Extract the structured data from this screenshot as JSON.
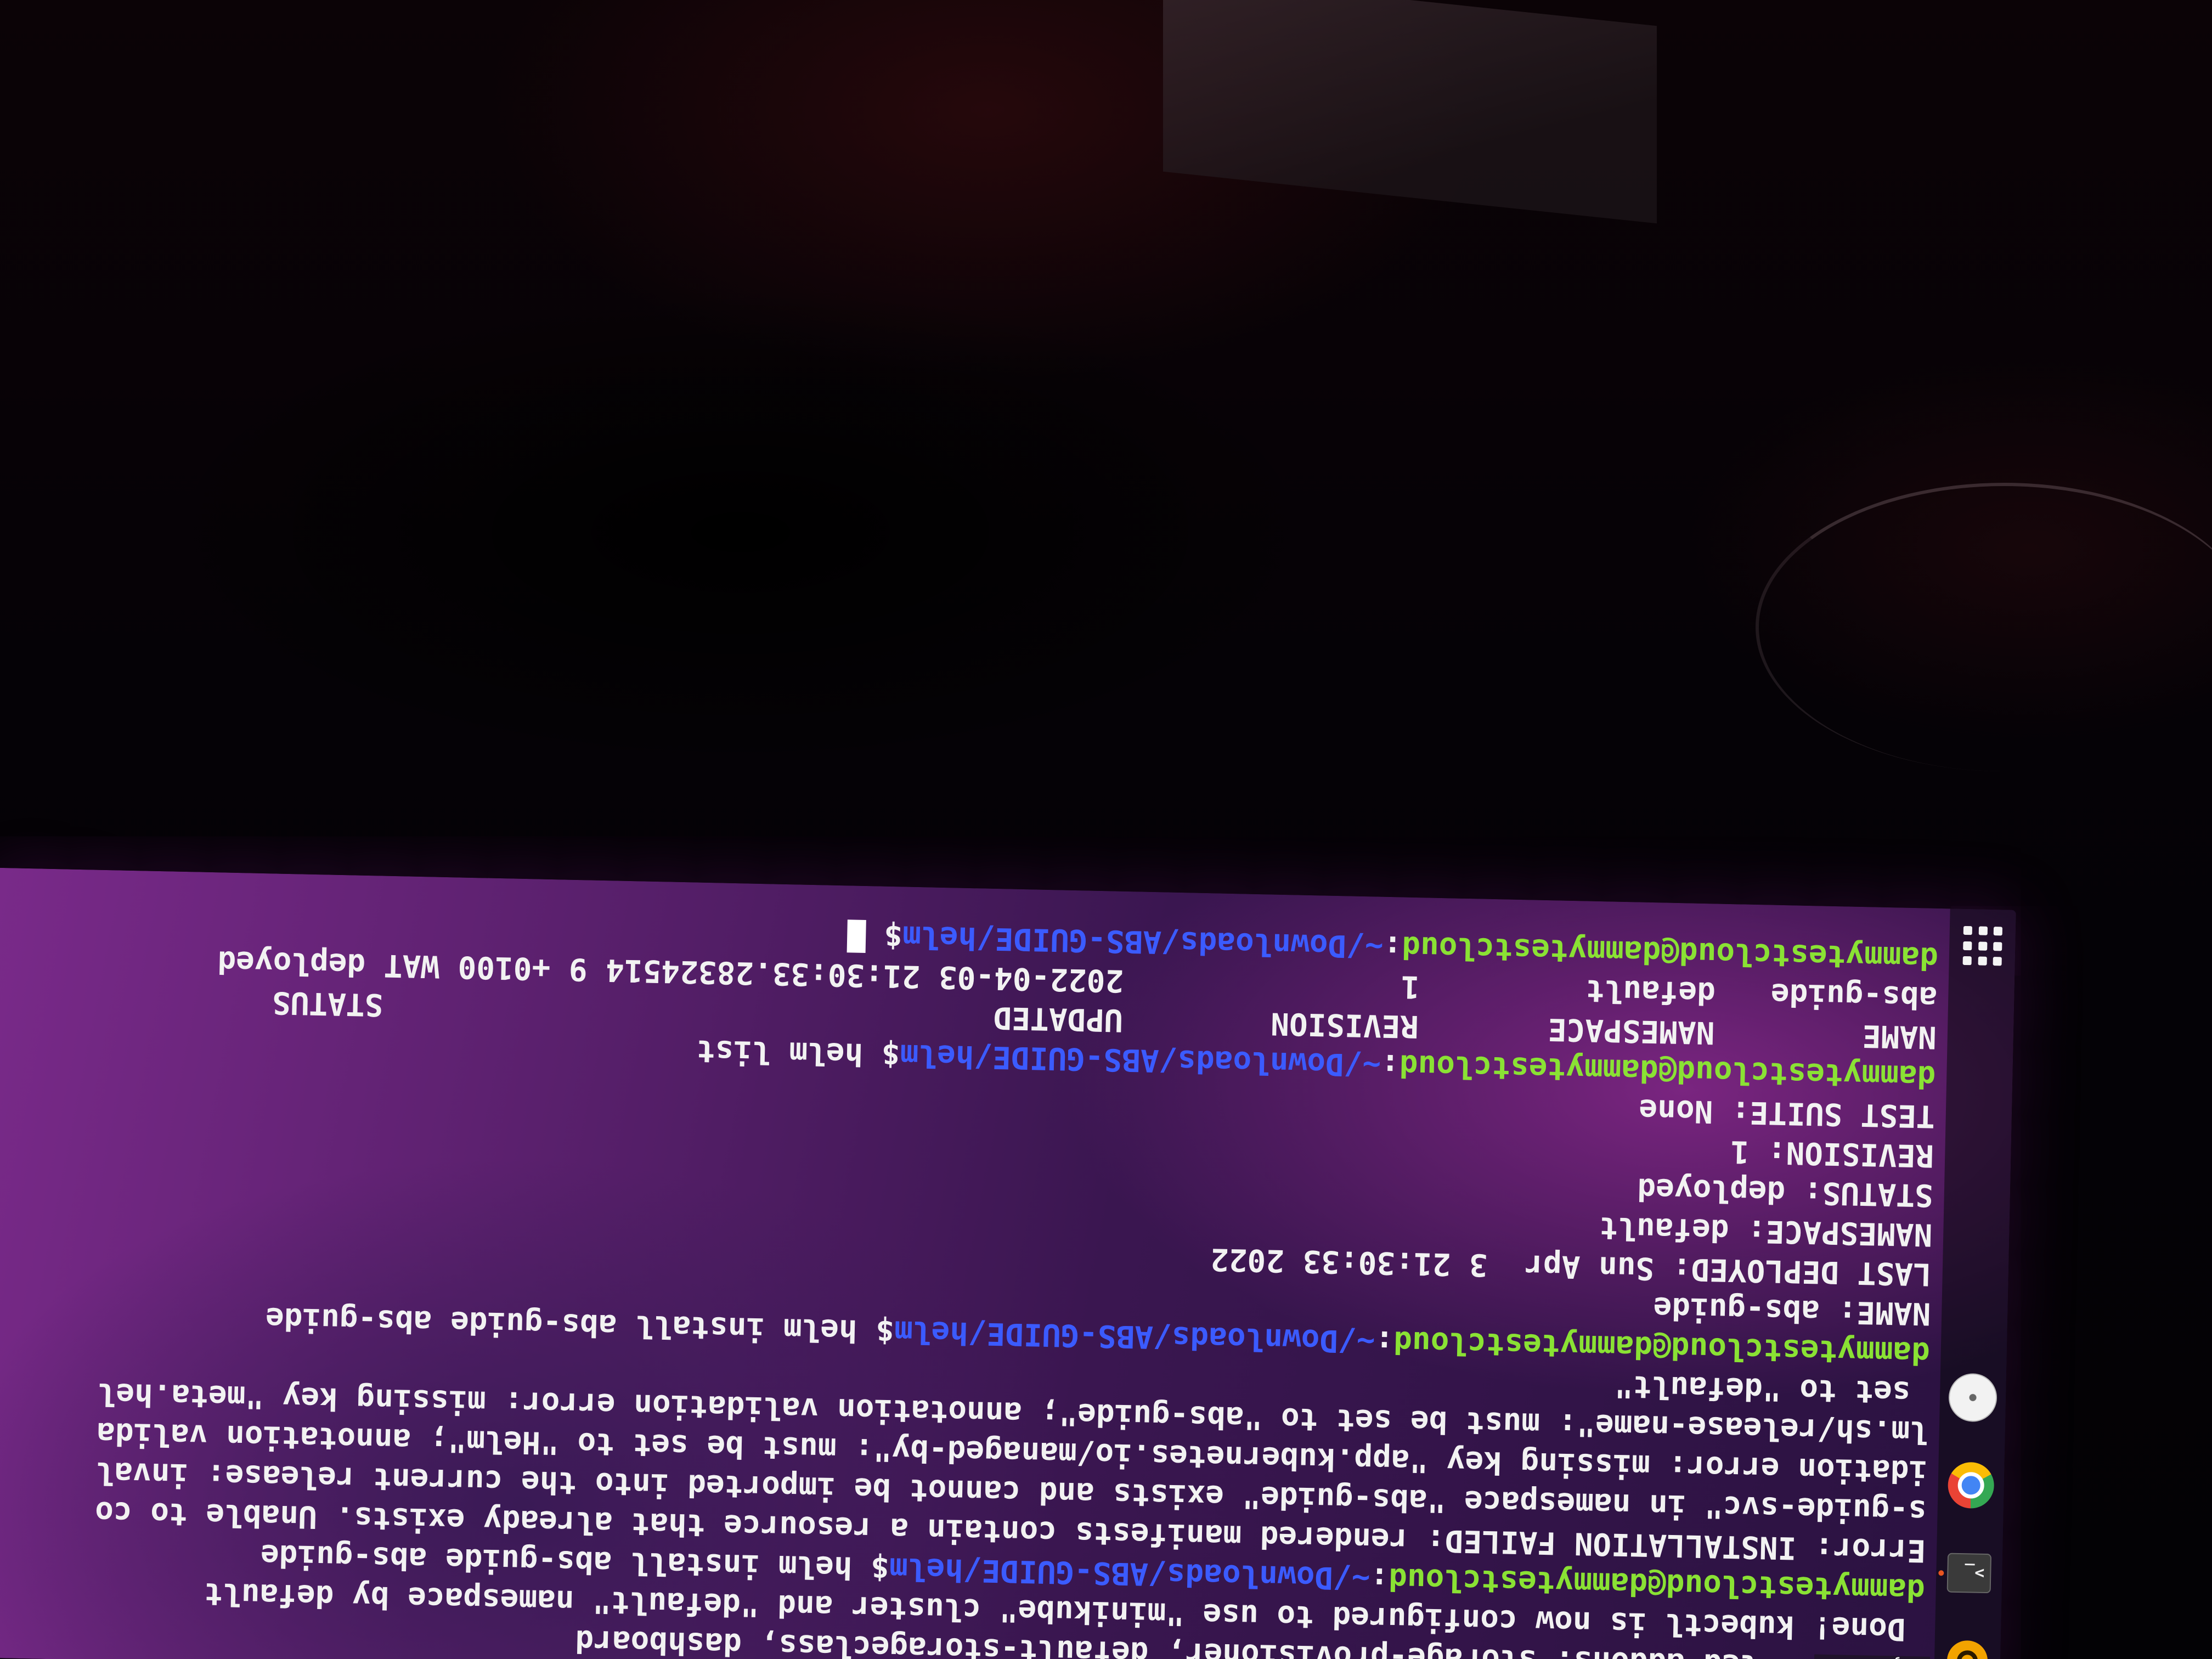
{
  "dock": {
    "tooltip": "Rhythmbox",
    "terminal_glyph": ">_",
    "items": [
      "rhythmbox-icon",
      "terminal-icon",
      "chrome-icon",
      "disc-icon",
      "show-apps-icon"
    ]
  },
  "colors": {
    "prompt_user": "#8ae234",
    "prompt_path": "#3b5bff",
    "text": "#f2f2f2"
  },
  "terminal": {
    "prompt_user": "dammytestcloud@dammytestcloud",
    "prompt_path": "~/Downloads/ABS-GUIDE/helm",
    "lines": [
      {
        "type": "out",
        "text": "led addons: storage-provisioner, default-storageclass, dashboard"
      },
      {
        "type": "out",
        "text": " Done! kubectl is now configured to use \"minikube\" cluster and \"default\" namespace by default"
      },
      {
        "type": "cmd",
        "text": "helm install abs-guide abs-guide"
      },
      {
        "type": "out",
        "text": "Error: INSTALLATION FAILED: rendered manifests contain a resource that already exists. Unable to co"
      },
      {
        "type": "out",
        "text": "s-guide-svc\" in namespace \"abs-guide\" exists and cannot be imported into the current release: inval"
      },
      {
        "type": "out",
        "text": "idation error: missing key \"app.kubernetes.io/managed-by\": must be set to \"Helm\"; annotation valida"
      },
      {
        "type": "out",
        "text": "lm.sh/release-name\": must be set to \"abs-guide\"; annotation validation error: missing key \"meta.hel"
      },
      {
        "type": "out",
        "text": " set to \"default\""
      },
      {
        "type": "cmd",
        "text": "helm install abs-guide abs-guide"
      },
      {
        "type": "out",
        "text": "NAME: abs-guide"
      },
      {
        "type": "out",
        "text": "LAST DEPLOYED: Sun Apr  3 21:30:33 2022"
      },
      {
        "type": "out",
        "text": "NAMESPACE: default"
      },
      {
        "type": "out",
        "text": "STATUS: deployed"
      },
      {
        "type": "out",
        "text": "REVISION: 1"
      },
      {
        "type": "out",
        "text": "TEST SUITE: None"
      },
      {
        "type": "cmd",
        "text": "helm list"
      },
      {
        "type": "out",
        "text": "NAME        NAMESPACE       REVISION        UPDATED                                 STATUS"
      },
      {
        "type": "out",
        "text": "abs-guide   default         1               2022-04-03 21:30:33.28324514 9 +0100 WAT deployed"
      },
      {
        "type": "cmd",
        "text": ""
      }
    ]
  }
}
